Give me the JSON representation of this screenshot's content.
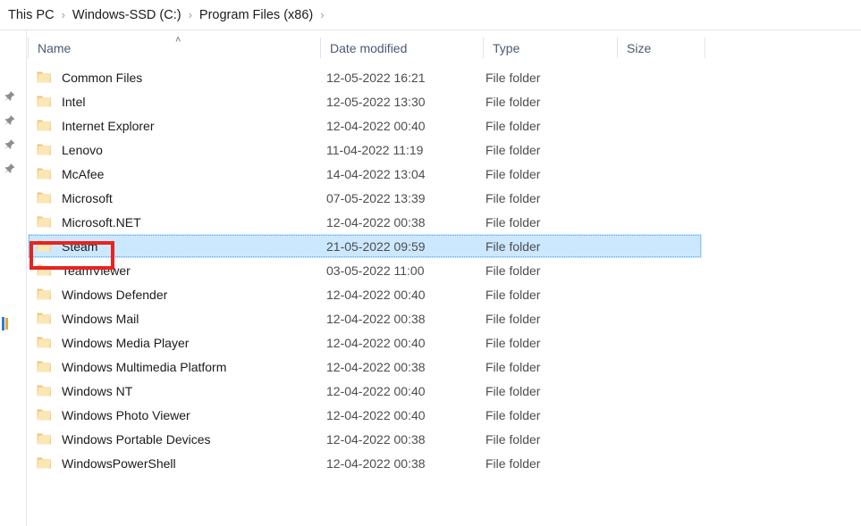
{
  "breadcrumb": {
    "separator": "›",
    "items": [
      {
        "label": "This PC"
      },
      {
        "label": "Windows-SSD (C:)"
      },
      {
        "label": "Program Files (x86)"
      }
    ]
  },
  "navpane": {
    "pin_icon_name": "pin-icon",
    "pin_count": 4
  },
  "columns": {
    "name": "Name",
    "date_modified": "Date modified",
    "type": "Type",
    "size": "Size",
    "sort_caret": "˄",
    "sort_column": "Name",
    "sort_direction": "ascending"
  },
  "files": [
    {
      "name": "Common Files",
      "date": "12-05-2022 16:21",
      "type": "File folder",
      "size": "",
      "selected": false
    },
    {
      "name": "Intel",
      "date": "12-05-2022 13:30",
      "type": "File folder",
      "size": "",
      "selected": false
    },
    {
      "name": "Internet Explorer",
      "date": "12-04-2022 00:40",
      "type": "File folder",
      "size": "",
      "selected": false
    },
    {
      "name": "Lenovo",
      "date": "11-04-2022 11:19",
      "type": "File folder",
      "size": "",
      "selected": false
    },
    {
      "name": "McAfee",
      "date": "14-04-2022 13:04",
      "type": "File folder",
      "size": "",
      "selected": false
    },
    {
      "name": "Microsoft",
      "date": "07-05-2022 13:39",
      "type": "File folder",
      "size": "",
      "selected": false
    },
    {
      "name": "Microsoft.NET",
      "date": "12-04-2022 00:38",
      "type": "File folder",
      "size": "",
      "selected": false
    },
    {
      "name": "Steam",
      "date": "21-05-2022 09:59",
      "type": "File folder",
      "size": "",
      "selected": true
    },
    {
      "name": "TeamViewer",
      "date": "03-05-2022 11:00",
      "type": "File folder",
      "size": "",
      "selected": false
    },
    {
      "name": "Windows Defender",
      "date": "12-04-2022 00:40",
      "type": "File folder",
      "size": "",
      "selected": false
    },
    {
      "name": "Windows Mail",
      "date": "12-04-2022 00:38",
      "type": "File folder",
      "size": "",
      "selected": false
    },
    {
      "name": "Windows Media Player",
      "date": "12-04-2022 00:40",
      "type": "File folder",
      "size": "",
      "selected": false
    },
    {
      "name": "Windows Multimedia Platform",
      "date": "12-04-2022 00:38",
      "type": "File folder",
      "size": "",
      "selected": false
    },
    {
      "name": "Windows NT",
      "date": "12-04-2022 00:40",
      "type": "File folder",
      "size": "",
      "selected": false
    },
    {
      "name": "Windows Photo Viewer",
      "date": "12-04-2022 00:40",
      "type": "File folder",
      "size": "",
      "selected": false
    },
    {
      "name": "Windows Portable Devices",
      "date": "12-04-2022 00:38",
      "type": "File folder",
      "size": "",
      "selected": false
    },
    {
      "name": "WindowsPowerShell",
      "date": "12-04-2022 00:38",
      "type": "File folder",
      "size": "",
      "selected": false
    }
  ],
  "annotation": {
    "target": "Steam",
    "color": "#e8231f",
    "shape": "rectangle"
  },
  "colors": {
    "selection_fill": "#cce8ff",
    "selection_border": "#5aa9e6",
    "folder_icon": "#f7d379",
    "header_text": "#4a5a70",
    "body_text": "#1b1b1b",
    "annotation_red": "#e8231f"
  }
}
